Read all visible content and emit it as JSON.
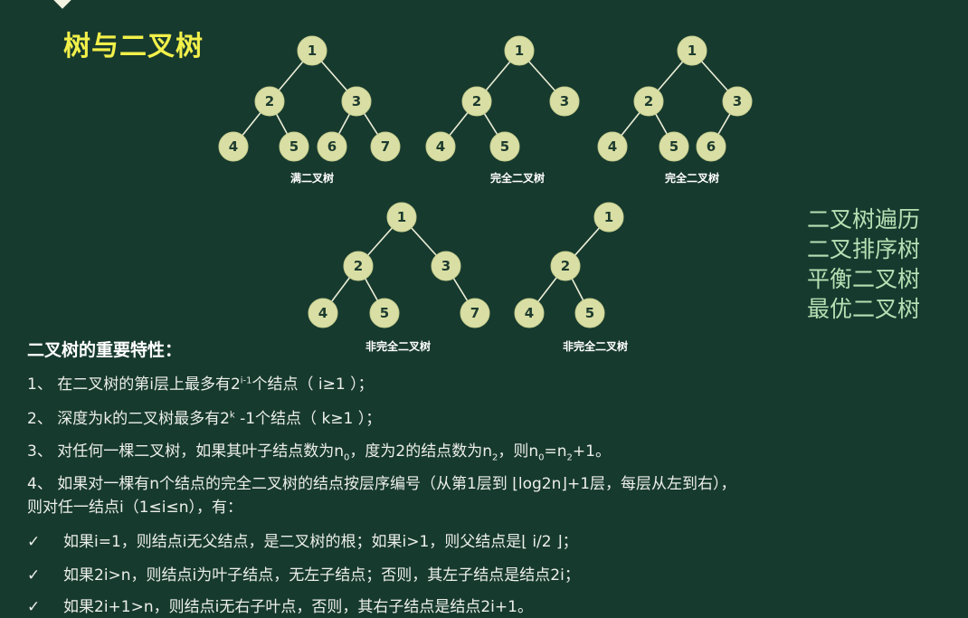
{
  "title": "树与二叉树",
  "trees": [
    {
      "caption": "满二叉树",
      "nodes": [
        "1",
        "2",
        "3",
        "4",
        "5",
        "6",
        "7"
      ]
    },
    {
      "caption": "完全二叉树",
      "nodes": [
        "1",
        "2",
        "3",
        "4",
        "5"
      ]
    },
    {
      "caption": "完全二叉树",
      "nodes": [
        "1",
        "2",
        "3",
        "4",
        "5",
        "6"
      ]
    },
    {
      "caption": "非完全二叉树",
      "nodes": [
        "1",
        "2",
        "3",
        "4",
        "5",
        "7"
      ]
    },
    {
      "caption": "非完全二叉树",
      "nodes": [
        "1",
        "2",
        "4",
        "5"
      ]
    }
  ],
  "side_topics": [
    "二叉树遍历",
    "二叉排序树",
    "平衡二叉树",
    "最优二叉树"
  ],
  "properties": {
    "heading": "二叉树的重要特性：",
    "p1": {
      "prefix": "1、 在二叉树的第i层上最多有2",
      "sup": "i-1",
      "suffix": "个结点（ i≥1 ）；"
    },
    "p2": {
      "prefix": "2、 深度为k的二叉树最多有2",
      "sup": "k",
      "suffix": " -1个结点（ k≥1 ）；"
    },
    "p3": {
      "a": "3、 对任何一棵二叉树，如果其叶子结点数为n",
      "a_sub": "0",
      "b": "，度为2的结点数为n",
      "b_sub": "2",
      "c": "，则n",
      "c_sub": "0",
      "d": "=n",
      "d_sub": "2",
      "e": "+1。"
    },
    "p4_line1": "4、 如果对一棵有n个结点的完全二叉树的结点按层序编号（从第1层到 ⌊log2n⌋+1层，每层从左到右），",
    "p4_line2": "则对任一结点i（1≤i≤n），有：",
    "check_mark": "✓",
    "checks": [
      "如果i=1，则结点i无父结点，是二叉树的根；如果i>1，则父结点是⌊ i/2 ⌋；",
      "如果2i>n，则结点i为叶子结点，无左子结点；否则，其左子结点是结点2i；",
      "如果2i+1>n，则结点i无右子叶点，否则，其右子结点是结点2i+1。"
    ]
  }
}
